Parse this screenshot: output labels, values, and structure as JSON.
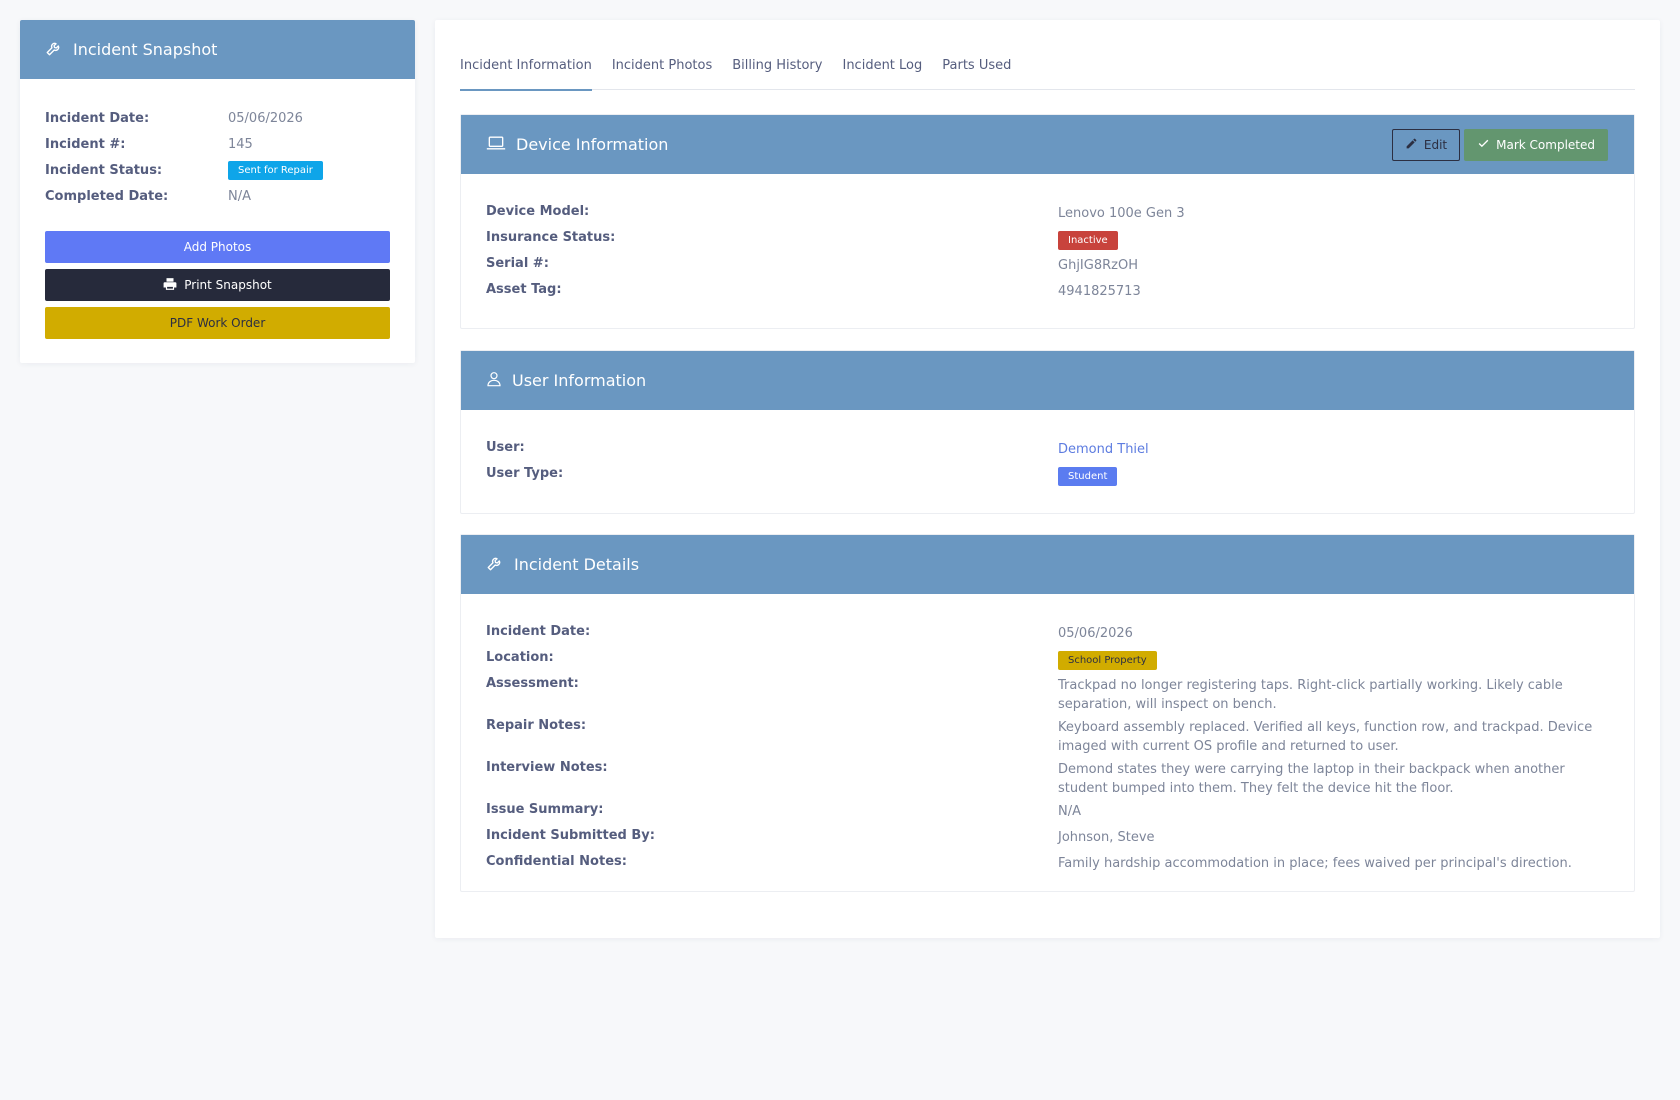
{
  "snapshot": {
    "title": "Incident Snapshot",
    "fields": [
      {
        "label": "Incident Date:",
        "value": "05/06/2026"
      },
      {
        "label": "Incident #:",
        "value": "145"
      },
      {
        "label": "Incident Status:",
        "value": "Sent for Repair"
      },
      {
        "label": "Completed Date:",
        "value": "N/A"
      }
    ],
    "buttons": {
      "add_photos": "Add Photos",
      "print_snapshot": "Print Snapshot",
      "pdf_work_order": "PDF Work Order"
    }
  },
  "tabs": [
    "Incident Information",
    "Incident Photos",
    "Billing History",
    "Incident Log",
    "Parts Used"
  ],
  "device": {
    "title": "Device Information",
    "edit_label": "Edit",
    "complete_label": "Mark Completed",
    "fields": [
      {
        "label": "Device Model:",
        "value": "Lenovo 100e Gen 3"
      },
      {
        "label": "Insurance Status:",
        "value": "Inactive"
      },
      {
        "label": "Serial #:",
        "value": "GhjIG8RzOH"
      },
      {
        "label": "Asset Tag:",
        "value": "4941825713"
      }
    ]
  },
  "user": {
    "title": "User Information",
    "fields": [
      {
        "label": "User:",
        "value": "Demond Thiel"
      },
      {
        "label": "User Type:",
        "value": "Student"
      }
    ]
  },
  "incident": {
    "title": "Incident Details",
    "fields": [
      {
        "label": "Incident Date:",
        "value": "05/06/2026"
      },
      {
        "label": "Location:",
        "value": "School Property"
      },
      {
        "label": "Assessment:",
        "value": "Trackpad no longer registering taps. Right-click partially working. Likely cable separation, will inspect on bench."
      },
      {
        "label": "Repair Notes:",
        "value": "Keyboard assembly replaced. Verified all keys, function row, and trackpad. Device imaged with current OS profile and returned to user."
      },
      {
        "label": "Interview Notes:",
        "value": "Demond states they were carrying the laptop in their backpack when another student bumped into them. They felt the device hit the floor."
      },
      {
        "label": "Issue Summary:",
        "value": "N/A"
      },
      {
        "label": "Incident Submitted By:",
        "value": "Johnson, Steve"
      },
      {
        "label": "Confidential Notes:",
        "value": "Family hardship accommodation in place; fees waived per principal's direction."
      }
    ]
  },
  "colors": {
    "header": "#6a97c1",
    "status_badge": "#0ea5e9",
    "inactive_badge": "#c8433c",
    "student_badge": "#5b7cf0",
    "location_badge": "#d1ac00",
    "add_photos": "#5f79f5",
    "print": "#262a3b",
    "pdf": "#d1ac00",
    "complete": "#63966f"
  }
}
